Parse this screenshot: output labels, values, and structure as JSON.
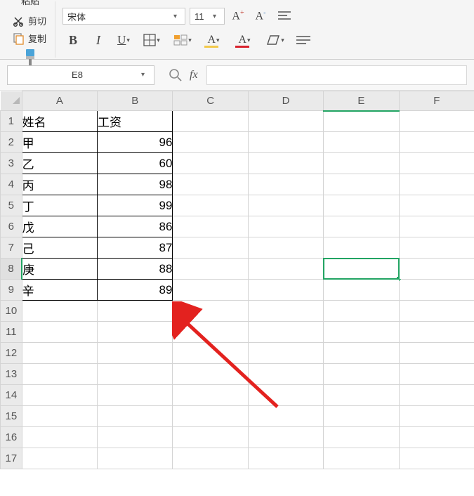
{
  "ribbon": {
    "paste_label": "粘贴",
    "cut_label": "剪切",
    "copy_label": "复制",
    "brush_label": "格式刷",
    "font_name": "宋体",
    "font_size": "11",
    "bold": "B",
    "italic": "I",
    "underline": "U",
    "font_inc": "A",
    "font_dec": "A"
  },
  "formula_bar": {
    "name_box": "E8",
    "fx": "fx",
    "value": ""
  },
  "columns": [
    "A",
    "B",
    "C",
    "D",
    "E",
    "F"
  ],
  "rows_visible": 17,
  "selected_cell": "E8",
  "data": {
    "headers": {
      "A": "姓名",
      "B": "工资"
    },
    "rows": [
      {
        "name": "甲",
        "salary": 96
      },
      {
        "name": "乙",
        "salary": 60
      },
      {
        "name": "丙",
        "salary": 98
      },
      {
        "name": "丁",
        "salary": 99
      },
      {
        "name": "戊",
        "salary": 86
      },
      {
        "name": "己",
        "salary": 87
      },
      {
        "name": "庚",
        "salary": 88
      },
      {
        "name": "辛",
        "salary": 89
      }
    ]
  },
  "chart_data": {
    "type": "table",
    "title": "",
    "columns": [
      "姓名",
      "工资"
    ],
    "rows": [
      [
        "甲",
        96
      ],
      [
        "乙",
        60
      ],
      [
        "丙",
        98
      ],
      [
        "丁",
        99
      ],
      [
        "戊",
        86
      ],
      [
        "己",
        87
      ],
      [
        "庚",
        88
      ],
      [
        "辛",
        89
      ]
    ]
  }
}
